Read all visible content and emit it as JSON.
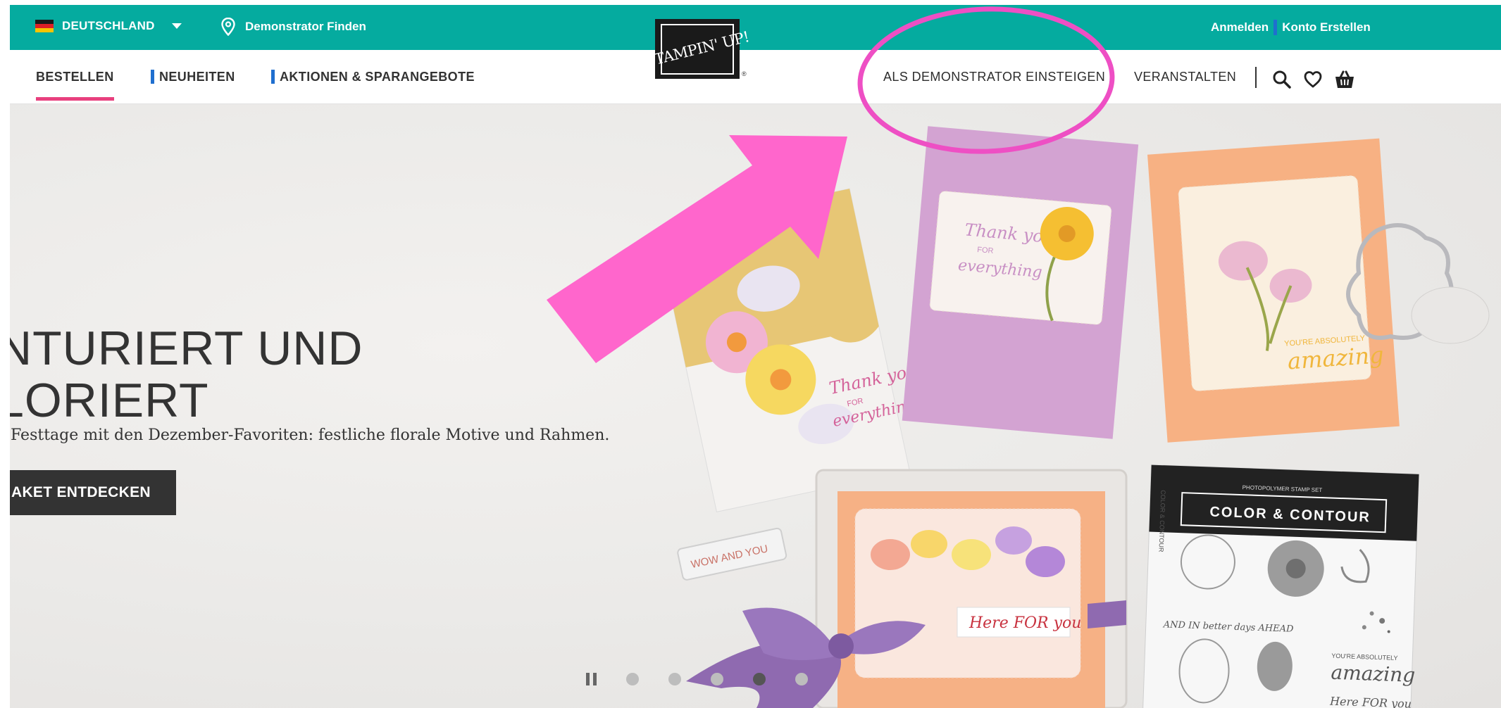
{
  "topbar": {
    "country_label": "DEUTSCHLAND",
    "finder_label": "Demonstrator Finden",
    "login_label": "Anmelden",
    "register_label": "Konto Erstellen",
    "bg_color": "#05ab9f"
  },
  "logo": {
    "text": "STAMPIN' UP!",
    "reg": "®"
  },
  "nav": {
    "left": [
      {
        "label": "BESTELLEN",
        "active": true
      },
      {
        "label": "NEUHEITEN"
      },
      {
        "label": "AKTIONEN & SPARANGEBOTE"
      }
    ],
    "right": [
      {
        "label": "ALS DEMONSTRATOR EINSTEIGEN"
      },
      {
        "label": "VERANSTALTEN"
      }
    ],
    "icons": [
      "search-icon",
      "heart-icon",
      "cart-icon"
    ],
    "active_color": "#e8407e",
    "marker_color": "#1f6fcf"
  },
  "hero": {
    "title_line1": "NTURIERT UND",
    "title_line2": "LORIERT",
    "subtitle": "Festtage mit den Dezember-Favoriten: festliche florale Motive und Rahmen.",
    "cta_label": "AKET ENTDECKEN",
    "cards": {
      "thank_you_1": "Thank you",
      "for_1": "FOR",
      "everything_1": "everything",
      "thank_you_2": "Thank you",
      "for_2": "FOR",
      "everything_2": "everything",
      "youre_absolutely": "YOU'RE ABSOLUTELY",
      "amazing": "amazing",
      "here_for_you": "Here FOR you",
      "stamp_block": "WOW AND YOU"
    },
    "stamp_set": {
      "kicker": "PHOTOPOLYMER STAMP SET",
      "title": "COLOR & CONTOUR",
      "side": "COLOR & CONTOUR",
      "better_days": "AND IN better days AHEAD",
      "youre_absolutely": "YOU'RE ABSOLUTELY",
      "amazing": "amazing",
      "here_for_you": "Here FOR you"
    },
    "carousel": {
      "total": 5,
      "active_index": 3
    }
  },
  "annotation": {
    "circle_color": "#ee4fc4",
    "arrow_color": "#ff66cc"
  }
}
